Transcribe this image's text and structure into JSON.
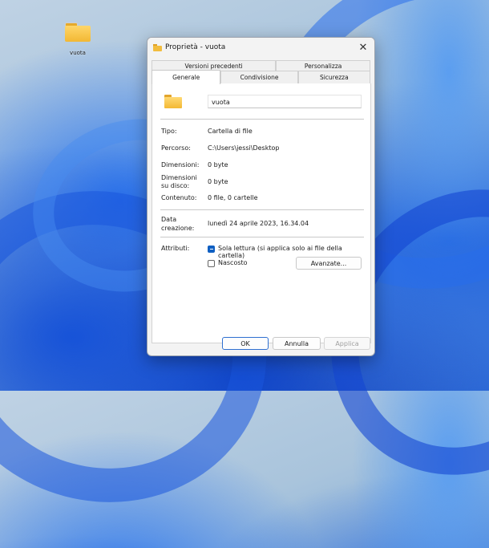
{
  "desktop": {
    "icon_label": "vuota"
  },
  "dialog": {
    "title": "Proprietà - vuota",
    "close_symbol": "✕",
    "tabs_back": [
      "Versioni precedenti",
      "Personalizza"
    ],
    "tabs_front": [
      "Generale",
      "Condivisione",
      "Sicurezza"
    ],
    "active_tab": "Generale",
    "folder_name": "vuota",
    "fields": {
      "tipo_label": "Tipo:",
      "tipo_value": "Cartella di file",
      "percorso_label": "Percorso:",
      "percorso_value": "C:\\Users\\jessi\\Desktop",
      "dimensioni_label": "Dimensioni:",
      "dimensioni_value": "0 byte",
      "dimensioni_disco_label_1": "Dimensioni",
      "dimensioni_disco_label_2": "su disco:",
      "dimensioni_disco_value": "0 byte",
      "contenuto_label": "Contenuto:",
      "contenuto_value": "0 file, 0 cartelle",
      "data_label_1": "Data",
      "data_label_2": "creazione:",
      "data_value": "lunedì 24 aprile 2023, 16.34.04",
      "attributi_label": "Attributi:"
    },
    "attributes": {
      "readonly_label": "Sola lettura (si applica solo ai file della cartella)",
      "readonly_checked": true,
      "hidden_label": "Nascosto",
      "hidden_checked": false,
      "advanced_button": "Avanzate..."
    },
    "buttons": {
      "ok": "OK",
      "cancel": "Annulla",
      "apply": "Applica"
    }
  },
  "colors": {
    "accent": "#0f5fc2",
    "folder": "#f3b834"
  }
}
